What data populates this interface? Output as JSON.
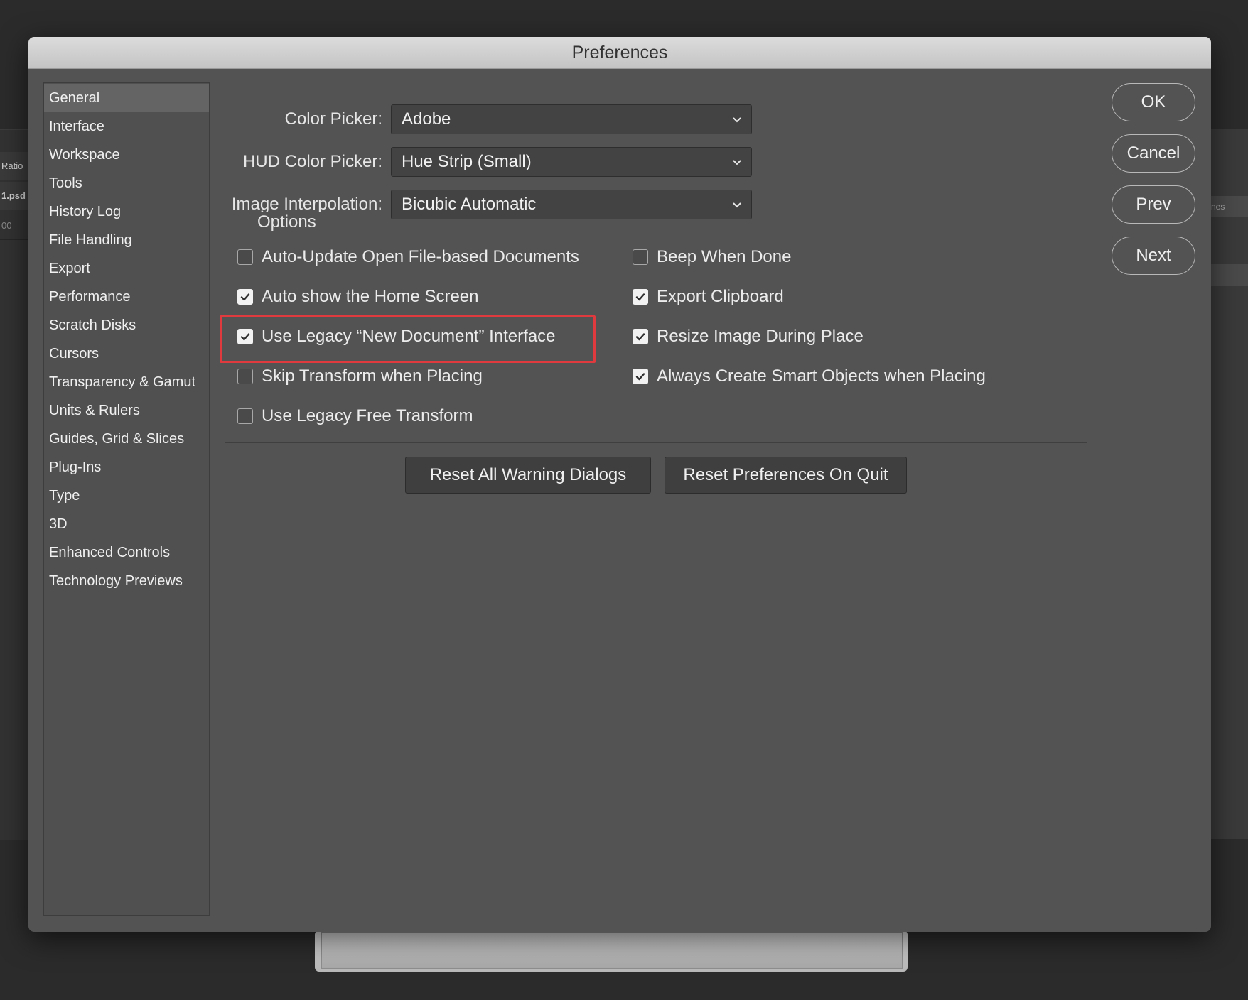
{
  "window": {
    "title": "Preferences"
  },
  "background": {
    "left_tabs": [
      "Ratio",
      "1.psd",
      "00"
    ],
    "right_tab": "nes"
  },
  "sidebar": {
    "items": [
      {
        "label": "General",
        "active": true
      },
      {
        "label": "Interface"
      },
      {
        "label": "Workspace"
      },
      {
        "label": "Tools"
      },
      {
        "label": "History Log"
      },
      {
        "label": "File Handling"
      },
      {
        "label": "Export"
      },
      {
        "label": "Performance"
      },
      {
        "label": "Scratch Disks"
      },
      {
        "label": "Cursors"
      },
      {
        "label": "Transparency & Gamut"
      },
      {
        "label": "Units & Rulers"
      },
      {
        "label": "Guides, Grid & Slices"
      },
      {
        "label": "Plug-Ins"
      },
      {
        "label": "Type"
      },
      {
        "label": "3D"
      },
      {
        "label": "Enhanced Controls"
      },
      {
        "label": "Technology Previews"
      }
    ]
  },
  "fields": {
    "color_picker": {
      "label": "Color Picker:",
      "value": "Adobe"
    },
    "hud_color_picker": {
      "label": "HUD Color Picker:",
      "value": "Hue Strip (Small)"
    },
    "image_interpolation": {
      "label": "Image Interpolation:",
      "value": "Bicubic Automatic"
    }
  },
  "options": {
    "title": "Options",
    "left": [
      {
        "label": "Auto-Update Open File-based Documents",
        "checked": false
      },
      {
        "label": "Auto show the Home Screen",
        "checked": true
      },
      {
        "label": "Use Legacy “New Document” Interface",
        "checked": true
      },
      {
        "label": "Skip Transform when Placing",
        "checked": false
      },
      {
        "label": "Use Legacy Free Transform",
        "checked": false
      }
    ],
    "right": [
      {
        "label": "Beep When Done",
        "checked": false
      },
      {
        "label": "Export Clipboard",
        "checked": true
      },
      {
        "label": "Resize Image During Place",
        "checked": true
      },
      {
        "label": "Always Create Smart Objects when Placing",
        "checked": true
      }
    ]
  },
  "buttons": {
    "reset_warnings": "Reset All Warning Dialogs",
    "reset_prefs": "Reset Preferences On Quit",
    "ok": "OK",
    "cancel": "Cancel",
    "prev": "Prev",
    "next": "Next"
  },
  "colors": {
    "highlight": "#e0393e",
    "dialog_bg": "#535353"
  }
}
